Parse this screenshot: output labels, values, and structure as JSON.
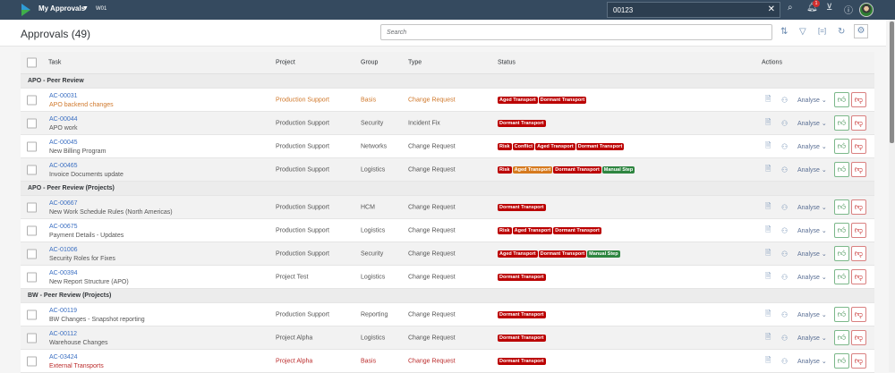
{
  "shell": {
    "app_title": "My Approvals",
    "system": "W01",
    "search_value": "00123",
    "notification_count": "1"
  },
  "page": {
    "title": "Approvals (49)",
    "search_placeholder": "Search"
  },
  "columns": {
    "task": "Task",
    "project": "Project",
    "group": "Group",
    "type": "Type",
    "status": "Status",
    "actions": "Actions"
  },
  "action_label": "Analyse",
  "colors": {
    "shell": "#354a5f",
    "link": "#3b6fc2",
    "tag_red": "#bb0000",
    "tag_orange": "#d67a1e",
    "tag_green": "#2e8540"
  },
  "groups": [
    {
      "title": "APO - Peer Review",
      "rows": [
        {
          "id": "AC-00031",
          "desc": "APO backend changes",
          "project": "Production Support",
          "group": "Basis",
          "type": "Change Request",
          "tags": [
            "Aged Transport",
            "Dormant Transport"
          ],
          "tone": "warn",
          "shaded": false
        },
        {
          "id": "AC-00044",
          "desc": "APO work",
          "project": "Production Support",
          "group": "Security",
          "type": "Incident Fix",
          "tags": [
            "Dormant Transport"
          ],
          "tone": "",
          "shaded": true
        },
        {
          "id": "AC-00045",
          "desc": "New Billing Program",
          "project": "Production Support",
          "group": "Networks",
          "type": "Change Request",
          "tags": [
            "Risk",
            "Conflict",
            "Aged Transport",
            "Dormant Transport"
          ],
          "tone": "",
          "shaded": false
        },
        {
          "id": "AC-00465",
          "desc": "Invoice Documents update",
          "project": "Production Support",
          "group": "Logistics",
          "type": "Change Request",
          "tags": [
            "Risk",
            "Aged Transport*",
            "Dormant Transport",
            "Manual Step"
          ],
          "tone": "",
          "shaded": true
        }
      ]
    },
    {
      "title": "APO - Peer Review (Projects)",
      "rows": [
        {
          "id": "AC-00667",
          "desc": "New Work Schedule Rules (North Americas)",
          "project": "Production Support",
          "group": "HCM",
          "type": "Change Request",
          "tags": [
            "Dormant Transport"
          ],
          "tone": "",
          "shaded": true
        },
        {
          "id": "AC-00675",
          "desc": "Payment Details - Updates",
          "project": "Production Support",
          "group": "Logistics",
          "type": "Change Request",
          "tags": [
            "Risk",
            "Aged Transport",
            "Dormant Transport"
          ],
          "tone": "",
          "shaded": false
        },
        {
          "id": "AC-01006",
          "desc": "Security Roles for Fixes",
          "project": "Production Support",
          "group": "Security",
          "type": "Change Request",
          "tags": [
            "Aged Transport",
            "Dormant Transport",
            "Manual Step"
          ],
          "tone": "",
          "shaded": true
        },
        {
          "id": "AC-00394",
          "desc": "New Report Structure (APO)",
          "project": "Project Test",
          "group": "Logistics",
          "type": "Change Request",
          "tags": [
            "Dormant Transport"
          ],
          "tone": "",
          "shaded": false
        }
      ]
    },
    {
      "title": "BW - Peer Review (Projects)",
      "rows": [
        {
          "id": "AC-00119",
          "desc": "BW Changes - Snapshot reporting",
          "project": "Production Support",
          "group": "Reporting",
          "type": "Change Request",
          "tags": [
            "Dormant Transport"
          ],
          "tone": "",
          "shaded": false
        },
        {
          "id": "AC-00112",
          "desc": "Warehouse Changes",
          "project": "Project Alpha",
          "group": "Logistics",
          "type": "Change Request",
          "tags": [
            "Dormant Transport"
          ],
          "tone": "",
          "shaded": true
        },
        {
          "id": "AC-03424",
          "desc": "External Transports",
          "project": "Project Alpha",
          "group": "Basis",
          "type": "Change Request",
          "tags": [
            "Dormant Transport"
          ],
          "tone": "err",
          "shaded": false
        }
      ]
    }
  ]
}
